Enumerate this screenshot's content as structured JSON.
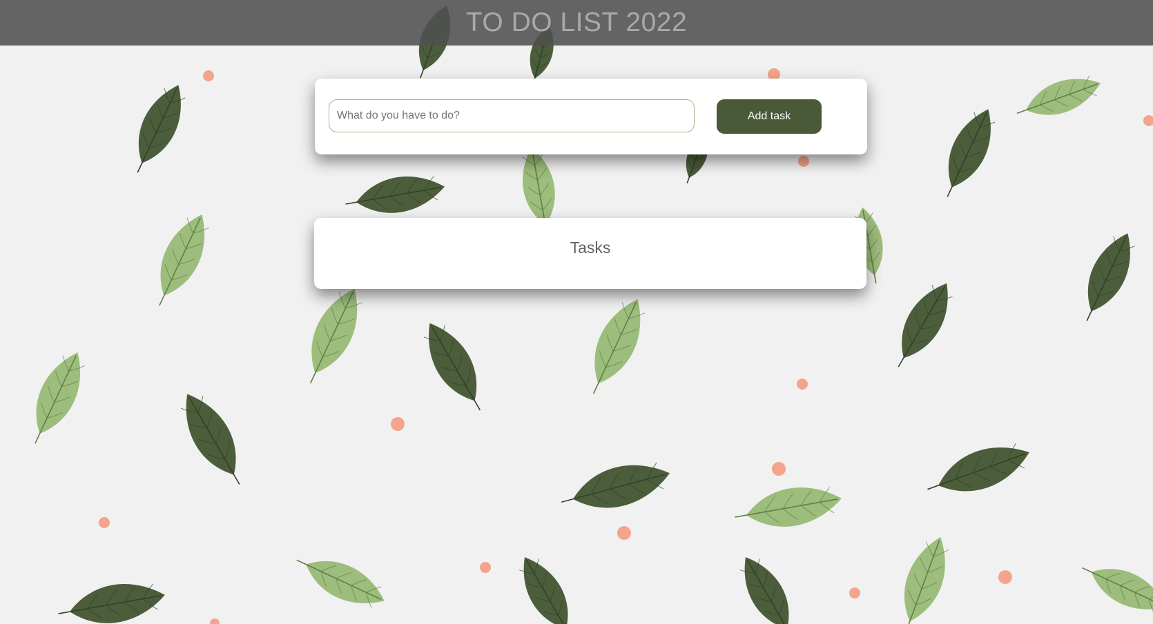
{
  "header": {
    "title": "TO DO LIST 2022"
  },
  "task_form": {
    "input_value": "",
    "input_placeholder": "What do you have to do?",
    "add_button_label": "Add task"
  },
  "tasks": {
    "heading": "Tasks",
    "items": []
  },
  "colors": {
    "background": "#f1f1f1",
    "header_bg": "#505050",
    "header_text": "#a9a9a9",
    "button_bg": "#4a5a38",
    "input_border": "#9ebd7e",
    "leaf_dark": "#4b5d3a",
    "leaf_dark_vein": "#33402a",
    "leaf_light": "#9cbd7c",
    "leaf_light_vein": "#5f7f45",
    "dot": "#f4a48c"
  },
  "background_decoration": {
    "pattern": "scattered-leaves-and-dots",
    "icons": [
      "leaf-icon",
      "dot-icon"
    ]
  }
}
